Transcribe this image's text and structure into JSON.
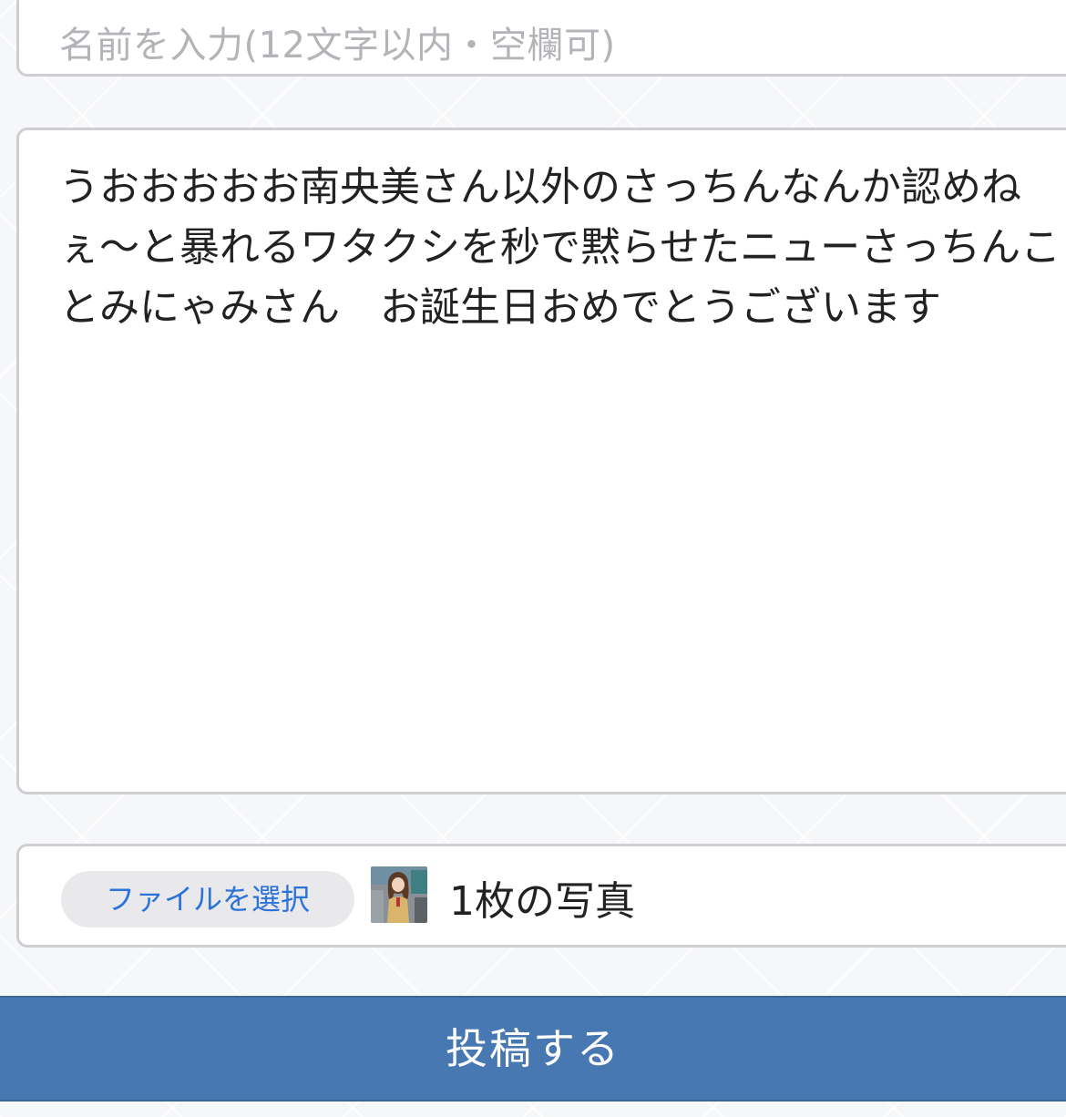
{
  "form": {
    "name_placeholder": "名前を入力(12文字以内・空欄可)",
    "message_value": "うおおおおお南央美さん以外のさっちんなんか認めねぇ〜と暴れるワタクシを秒で黙らせたニューさっちんことみにゃみさん　お誕生日おめでとうございます",
    "file_button_label": "ファイルを選択",
    "file_status": "1枚の写真",
    "submit_label": "投稿する"
  },
  "icons": {
    "thumbnail": "photo-thumbnail"
  },
  "colors": {
    "accent": "#4778b2",
    "link": "#2b73d9",
    "border": "#cfcfd3",
    "background": "#f6f7f9"
  }
}
